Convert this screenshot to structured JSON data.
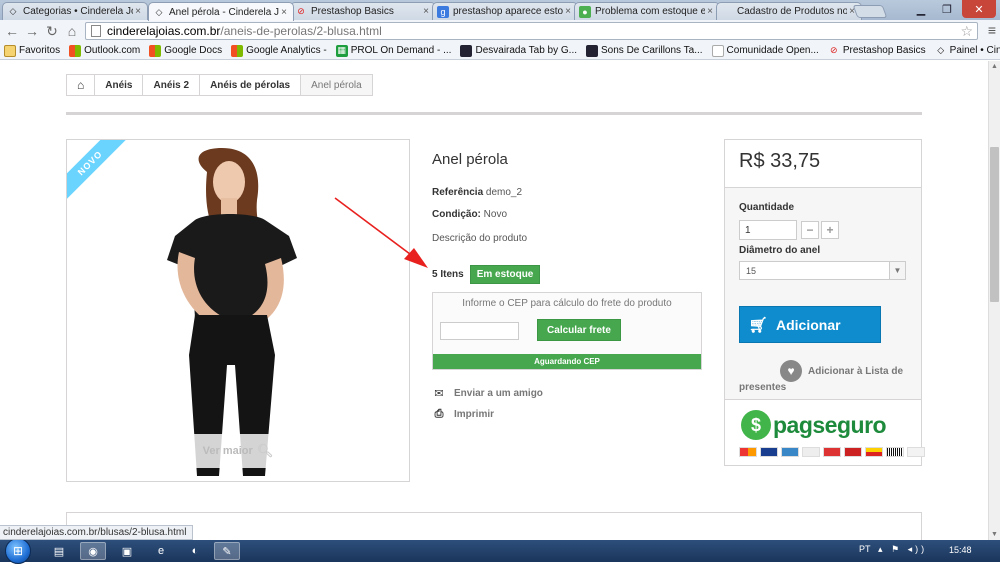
{
  "browser": {
    "tabs": [
      {
        "title": "Categorias • Cinderela Joi",
        "favicon": "diamond-icon",
        "active": false
      },
      {
        "title": "Anel pérola - Cinderela Jo",
        "favicon": "diamond-icon",
        "active": true
      },
      {
        "title": "Prestashop Basics",
        "favicon": "prestashop-icon",
        "active": false
      },
      {
        "title": "prestashop aparece estoq",
        "favicon": "google-icon",
        "active": false
      },
      {
        "title": "Problema com estoque e",
        "favicon": "forum-icon",
        "active": false
      },
      {
        "title": "Cadastro de Produtos no",
        "favicon": "blank-icon",
        "active": false
      }
    ],
    "url_host": "cinderelajoias.com.br",
    "url_path": "/aneis-de-perolas/2-blusa.html",
    "bookmarks": [
      {
        "label": "Favoritos",
        "icon": "folder-icon"
      },
      {
        "label": "Outlook.com",
        "icon": "windows-icon"
      },
      {
        "label": "Google Docs",
        "icon": "windows-icon"
      },
      {
        "label": "Google Analytics -",
        "icon": "windows-icon"
      },
      {
        "label": "PROL On Demand - ...",
        "icon": "sheet-icon"
      },
      {
        "label": "Desvairada Tab by G...",
        "icon": "image-icon"
      },
      {
        "label": "Sons De Carillons Ta...",
        "icon": "image-icon"
      },
      {
        "label": "Comunidade Open...",
        "icon": "page-icon"
      },
      {
        "label": "Prestashop Basics",
        "icon": "prestashop-icon"
      },
      {
        "label": "Painel • Cinderela Jo...",
        "icon": "diamond-icon"
      }
    ],
    "status_url": "cinderelajoias.com.br/blusas/2-blusa.html"
  },
  "breadcrumb": [
    "Anéis",
    "Anéis 2",
    "Anéis de pérolas",
    "Anel pérola"
  ],
  "product": {
    "badge": "NOVO",
    "zoom_label": "Ver maior",
    "name": "Anel pérola",
    "reference_label": "Referência",
    "reference_value": "demo_2",
    "condition_label": "Condição:",
    "condition_value": "Novo",
    "description": "Descrição do produto",
    "stock_qty": "5 Itens",
    "stock_status": "Em estoque",
    "cep_title": "Informe o CEP para cálculo do frete do produto",
    "cep_button": "Calcular frete",
    "cep_status": "Aguardando CEP",
    "send_friend": "Enviar a um amigo",
    "print": "Imprimir"
  },
  "buy_box": {
    "price": "R$ 33,75",
    "quantity_label": "Quantidade",
    "quantity_value": "1",
    "diameter_label": "Diâmetro do anel",
    "diameter_value": "15",
    "add_button": "Adicionar",
    "wishlist": "Adicionar à Lista de presentes",
    "payment_brand": "pagseguro"
  },
  "taskbar": {
    "language": "PT",
    "clock": "15:48"
  },
  "colors": {
    "green": "#46a74e",
    "blue_button": "#0e8ccd",
    "ribbon": "#6ad4ff",
    "annotation_red": "#e8211f"
  }
}
